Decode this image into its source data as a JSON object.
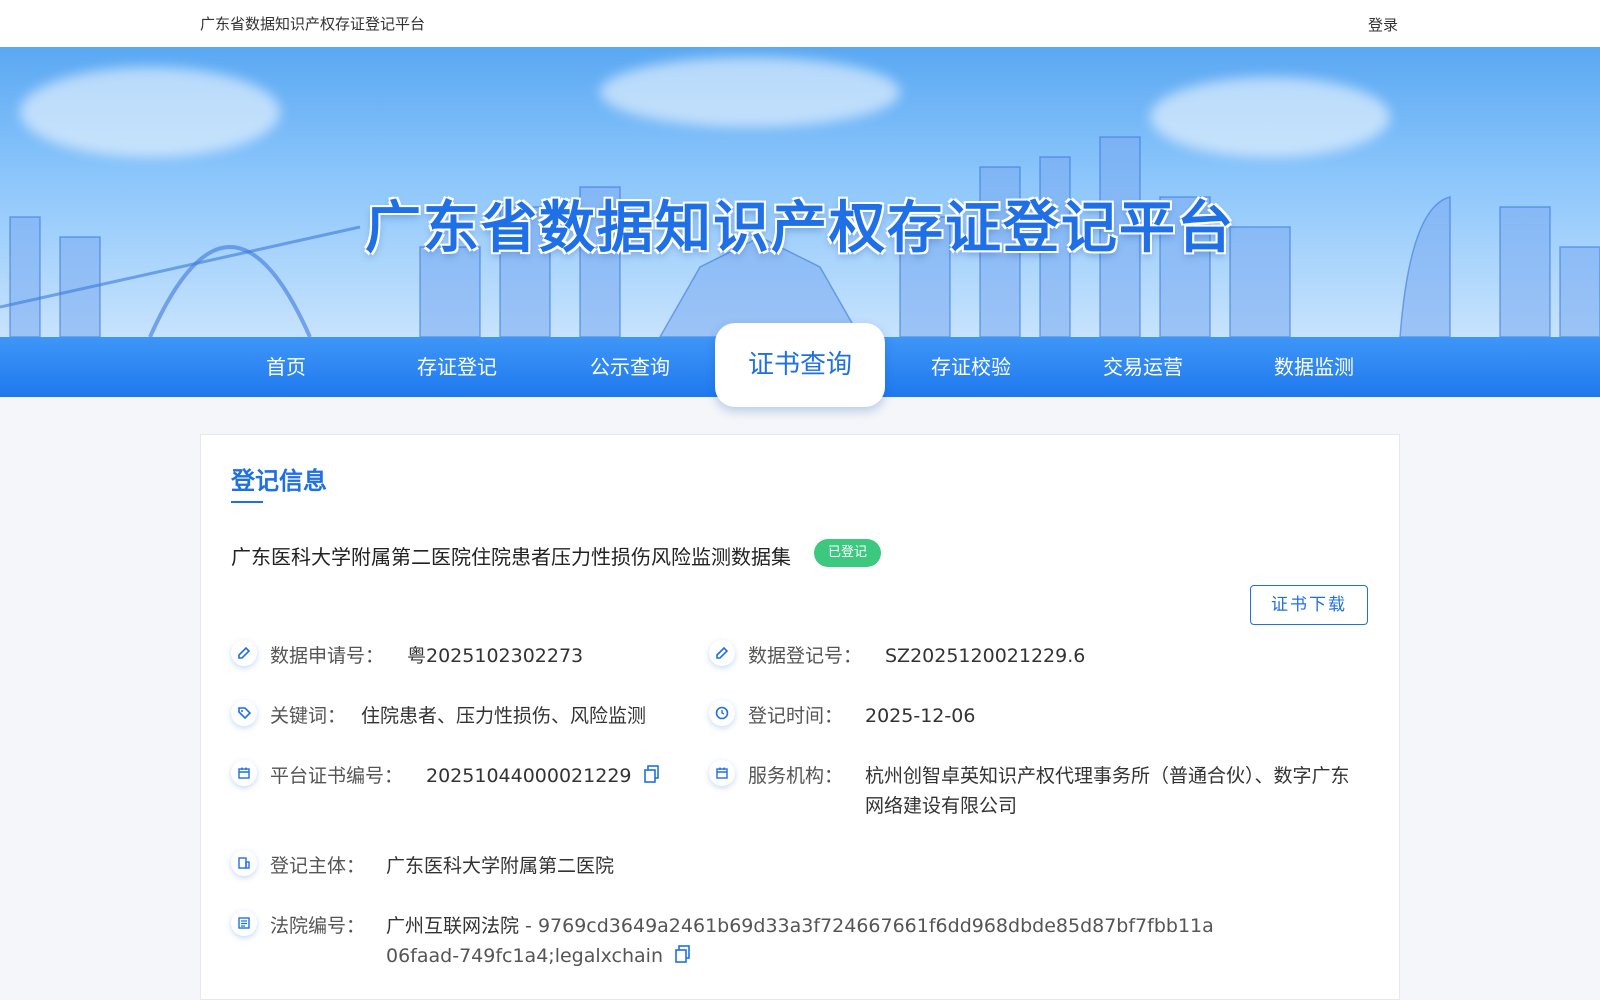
{
  "topbar": {
    "site_name": "广东省数据知识产权存证登记平台",
    "login_label": "登录"
  },
  "banner": {
    "title": "广东省数据知识产权存证登记平台"
  },
  "nav": {
    "items": [
      {
        "label": "首页"
      },
      {
        "label": "存证登记"
      },
      {
        "label": "公示查询"
      },
      {
        "label": "证书查询",
        "active": true
      },
      {
        "label": "存证校验"
      },
      {
        "label": "交易运营"
      },
      {
        "label": "数据监测"
      }
    ]
  },
  "registration": {
    "section_title": "登记信息",
    "dataset_name": "广东医科大学附属第二医院住院患者压力性损伤风险监测数据集",
    "status": "已登记",
    "download_label": "证书下载",
    "fields": {
      "application_no": {
        "label": "数据申请号：",
        "value": "粤2025102302273"
      },
      "registration_no": {
        "label": "数据登记号：",
        "value": "SZ2025120021229.6"
      },
      "keywords": {
        "label": "关键词：",
        "value": "住院患者、压力性损伤、风险监测"
      },
      "registration_time": {
        "label": "登记时间：",
        "value": "2025-12-06"
      },
      "certificate_no": {
        "label": "平台证书编号：",
        "value": "20251044000021229"
      },
      "service_agency": {
        "label": "服务机构：",
        "value": "杭州创智卓英知识产权代理事务所（普通合伙）、数字广东网络建设有限公司"
      },
      "registrant": {
        "label": "登记主体：",
        "value": "广东医科大学附属第二医院"
      },
      "court_no": {
        "label": "法院编号：",
        "value_court": "广州互联网法院",
        "value_hash": " - 9769cd3649a2461b69d33a3f724667661f6dd968dbde85d87bf7fbb11a06faad-749fc1a4;legalxchain"
      }
    }
  },
  "colors": {
    "primary": "#1f6fe6",
    "status_green": "#3cc97f",
    "nav_blue": "#2a85f2"
  }
}
